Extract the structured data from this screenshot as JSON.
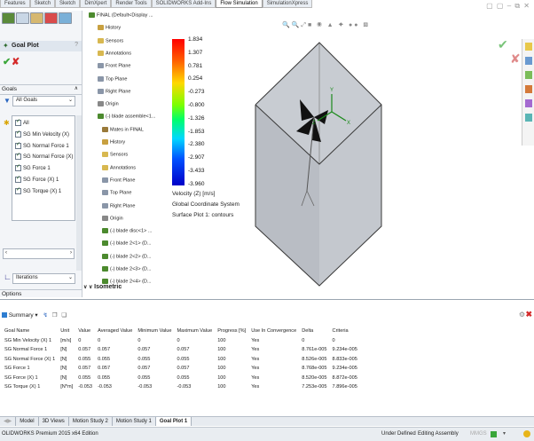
{
  "ribbon": {
    "tabs": [
      "Features",
      "Sketch",
      "Sketch",
      "DimXpert",
      "Render Tools",
      "SOLIDWORKS Add-Ins",
      "Flow Simulation",
      "SimulationXpress"
    ],
    "active_tab": "Flow Simulation"
  },
  "left_panel": {
    "title": "Goal Plot",
    "goals_header": "Goals",
    "goals_dropdown": "All Goals",
    "items": [
      {
        "label": "All",
        "checked": true
      },
      {
        "label": "SG Min Velocity (X)",
        "checked": true
      },
      {
        "label": "SG Normal Force 1",
        "checked": true
      },
      {
        "label": "SG Normal Force (X)",
        "checked": true
      },
      {
        "label": "SG Force 1",
        "checked": true
      },
      {
        "label": "SG Force (X) 1",
        "checked": true
      },
      {
        "label": "SG Torque (X) 1",
        "checked": true
      }
    ],
    "iterations_dropdown": "Iterations",
    "options_header": "Options"
  },
  "tree": [
    "FINAL (Default<Display ...",
    "History",
    "Sensors",
    "Annotations",
    "Front Plane",
    "Top Plane",
    "Right Plane",
    "Origin",
    "(-) blade assemble<1...",
    "Mates in FINAL",
    "History",
    "Sensors",
    "Annotations",
    "Front Plane",
    "Top Plane",
    "Right Plane",
    "Origin",
    "(-) blade disc<1> ...",
    "(-) blade 2<1> (D...",
    "(-) blade 2<2> (D...",
    "(-) blade 2<3> (D...",
    "(-) blade 2<4> (D..."
  ],
  "viewport": {
    "legend_values": [
      "1.834",
      "1.307",
      "0.781",
      "0.254",
      "-0.273",
      "-0.800",
      "-1.326",
      "-1.853",
      "-2.380",
      "-2.907",
      "-3.433",
      "-3.960"
    ],
    "legend_caption": [
      "Velocity (Z) [m/s]",
      "Global Coordinate System",
      "Surface Plot 1: contours"
    ],
    "view_label": "Isometric"
  },
  "summary": {
    "dropdown_label": "Summary",
    "columns": [
      "Goal Name",
      "Unit",
      "Value",
      "Averaged Value",
      "Minimum Value",
      "Maximum Value",
      "Progress [%]",
      "Use In Convergence",
      "Delta",
      "Criteria"
    ],
    "rows": [
      [
        "SG Min Velocity (X) 1",
        "[m/s]",
        "0",
        "0",
        "0",
        "0",
        "100",
        "Yes",
        "0",
        "0"
      ],
      [
        "SG Normal Force 1",
        "[N]",
        "0.057",
        "0.057",
        "0.057",
        "0.057",
        "100",
        "Yes",
        "8.761e-005",
        "9.234e-005"
      ],
      [
        "SG Normal Force (X) 1",
        "[N]",
        "0.055",
        "0.055",
        "0.055",
        "0.055",
        "100",
        "Yes",
        "8.526e-005",
        "8.833e-005"
      ],
      [
        "SG Force 1",
        "[N]",
        "0.057",
        "0.057",
        "0.057",
        "0.057",
        "100",
        "Yes",
        "8.768e-005",
        "9.234e-005"
      ],
      [
        "SG Force (X) 1",
        "[N]",
        "0.055",
        "0.055",
        "0.055",
        "0.055",
        "100",
        "Yes",
        "8.520e-005",
        "8.872e-005"
      ],
      [
        "SG Torque (X) 1",
        "[N*m]",
        "-0.053",
        "-0.053",
        "-0.053",
        "-0.053",
        "100",
        "Yes",
        "7.253e-005",
        "7.896e-005"
      ]
    ]
  },
  "model_tabs": [
    "Model",
    "3D Views",
    "Motion Study 2",
    "Motion Study 1",
    "Goal Plot 1"
  ],
  "model_tabs_active": "Goal Plot 1",
  "status": {
    "left": "OLIDWORKS Premium 2015 x64 Edition",
    "under_defined": "Under Defined",
    "editing": "Editing Assembly",
    "units": "MMGS"
  },
  "colors": {
    "accent_green": "#3aa63a",
    "accent_red": "#d42a2a",
    "panel_bg": "#f3f5f8"
  }
}
